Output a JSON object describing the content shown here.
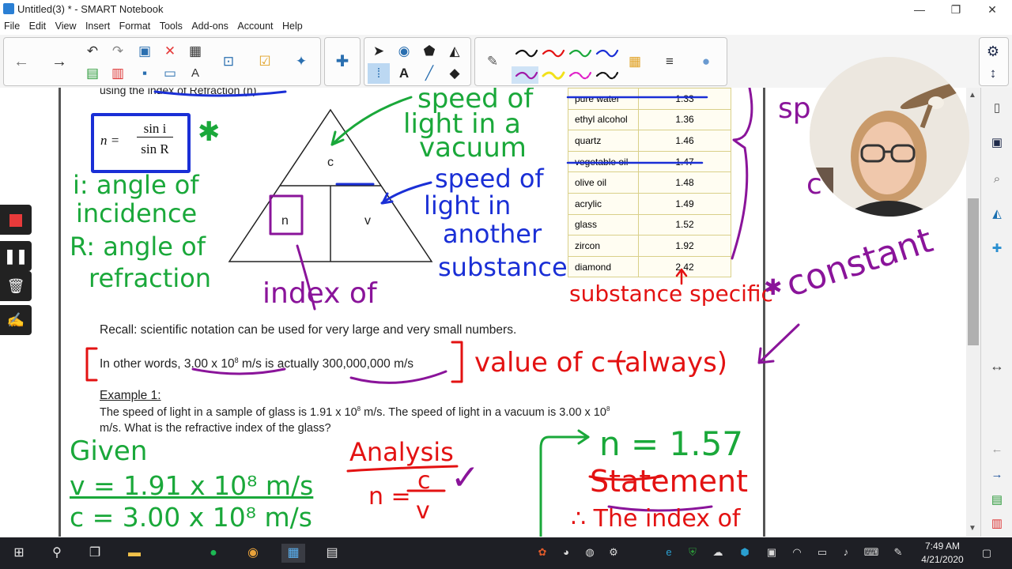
{
  "window": {
    "title": "Untitled(3) * - SMART Notebook",
    "minimize": "—",
    "restore": "❐",
    "close": "✕"
  },
  "menu": [
    "File",
    "Edit",
    "View",
    "Insert",
    "Format",
    "Tools",
    "Add-ons",
    "Account",
    "Help"
  ],
  "icons": {
    "back": "back-arrow-icon",
    "forward": "forward-arrow-icon",
    "undo": "undo-icon",
    "redo": "redo-icon",
    "delete": "delete-icon",
    "table": "table-icon",
    "select": "select-arrow-icon",
    "text": "text-icon",
    "eraser": "eraser-icon",
    "pen": "pen-icon",
    "settings": "gear-icon"
  },
  "colors": {
    "green_ink": "#1aa83a",
    "blue_ink": "#1a2fd6",
    "purple_ink": "#8a149a",
    "red_ink": "#e31212",
    "highlighter": "#f6ec2e"
  },
  "document": {
    "top_partial": "using the index of Refraction (n).",
    "formula_n": "n =",
    "formula_num": "sin i",
    "formula_den": "sin R",
    "triangle_top": "c",
    "triangle_left": "n",
    "triangle_right": "v",
    "recall": "Recall: scientific notation can be used for very large and very small numbers.",
    "other_words_prefix": "In other words, ",
    "other_words_value1": "3.00 x 10",
    "other_words_exp1": "8",
    "other_words_unit1": " m/s",
    "other_words_mid": " is actually ",
    "other_words_value2": "300,000,000 m/s",
    "example_heading": "Example 1:",
    "example_line1_a": "The speed of light in a sample of glass is 1.91 x 10",
    "example_line1_exp": "8",
    "example_line1_b": " m/s.  The speed of light in a vacuum is 3.00 x 10",
    "example_line1_exp2": "8",
    "example_line2": "m/s.  What is the refractive index of the glass?"
  },
  "refraction_table": [
    {
      "name": "pure water",
      "value": "1.33"
    },
    {
      "name": "ethyl alcohol",
      "value": "1.36"
    },
    {
      "name": "quartz",
      "value": "1.46"
    },
    {
      "name": "vegetable oil",
      "value": "1.47"
    },
    {
      "name": "olive oil",
      "value": "1.48"
    },
    {
      "name": "acrylic",
      "value": "1.49"
    },
    {
      "name": "glass",
      "value": "1.52"
    },
    {
      "name": "zircon",
      "value": "1.92"
    },
    {
      "name": "diamond",
      "value": "2.42"
    }
  ],
  "handwriting": {
    "speed_vacuum_1": "speed of",
    "speed_vacuum_2": "light in a",
    "speed_vacuum_3": "vacuum",
    "speed_other_1": "speed of",
    "speed_other_2": "light in",
    "speed_other_3": "another",
    "speed_other_4": "substance",
    "angle_i_1": "i: angle of",
    "angle_i_2": "incidence",
    "angle_R_1": "R: angle of",
    "angle_R_2": "refraction",
    "index_of": "index of",
    "substance_specific": "substance specific",
    "constant": "constant",
    "value_of_c": "value of c (always)",
    "given": "Given",
    "given_v": "v = 1.91 x 10⁸ m/s",
    "given_c": "c = 3.00 x 10⁸ m/s",
    "analysis": "Analysis",
    "analysis_formula_n": "n =",
    "analysis_formula_c": "c",
    "analysis_formula_v": "v",
    "answer": "n = 1.57",
    "statement": "Statement",
    "statement_line": "∴ The index of",
    "star": "✱",
    "check": "✓",
    "side_top": "sp",
    "side_mid": "c"
  },
  "taskbar": {
    "time": "7:49 AM",
    "date": "4/21/2020"
  }
}
